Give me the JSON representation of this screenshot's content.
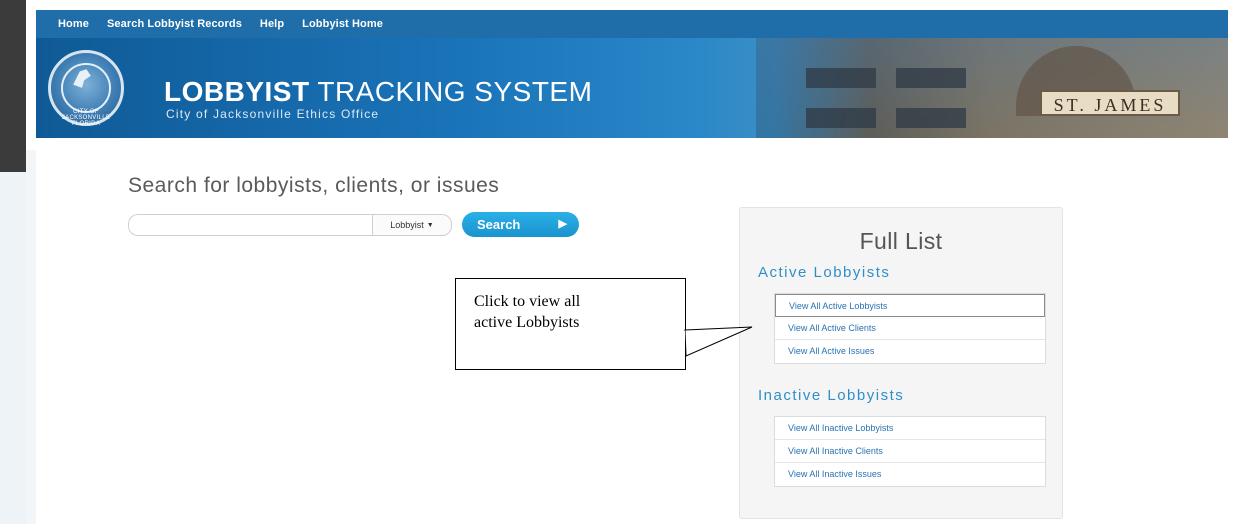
{
  "nav": {
    "items": [
      "Home",
      "Search Lobbyist Records",
      "Help",
      "Lobbyist Home"
    ]
  },
  "banner": {
    "title_bold": "LOBBYIST",
    "title_rest": " TRACKING SYSTEM",
    "subtitle": "City of Jacksonville Ethics Office",
    "seal_text": "CITY OF JACKSONVILLE FLORIDA",
    "sign_text": "ST. JAMES"
  },
  "search": {
    "heading": "Search for lobbyists, clients, or issues",
    "input_value": "",
    "type_label": "Lobbyist",
    "button_label": "Search"
  },
  "full_list": {
    "title": "Full List",
    "active": {
      "heading": "Active Lobbyists",
      "items": [
        "View All Active Lobbyists",
        "View All Active Clients",
        "View All Active Issues"
      ]
    },
    "inactive": {
      "heading": "Inactive Lobbyists",
      "items": [
        "View All Inactive Lobbyists",
        "View All Inactive Clients",
        "View All Inactive Issues"
      ]
    }
  },
  "callout": {
    "text_line1": "Click to view all",
    "text_line2": "active Lobbyists"
  },
  "colors": {
    "nav_bg": "#1f6ea9",
    "accent": "#2f8fc8",
    "link": "#2a73b3",
    "button": "#1a93cf"
  }
}
